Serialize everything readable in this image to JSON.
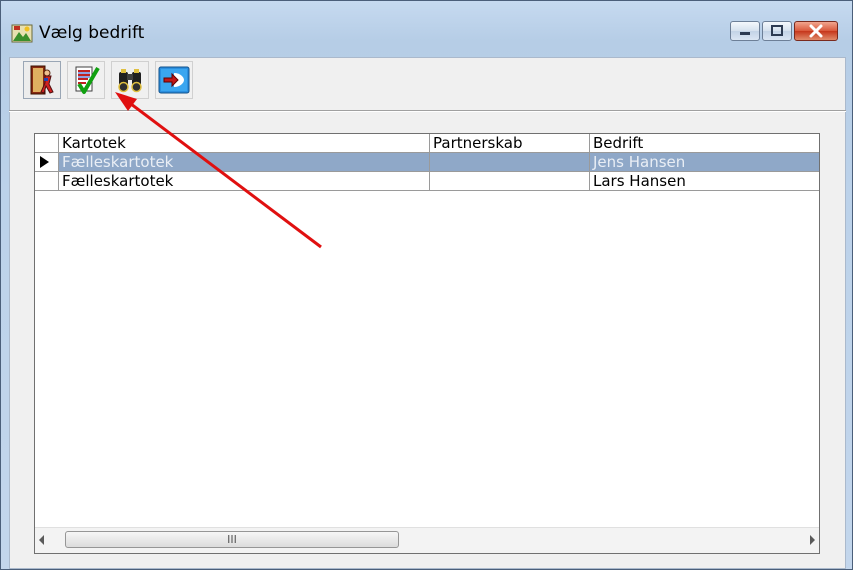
{
  "window": {
    "title": "Vælg bedrift"
  },
  "toolbar": {
    "buttons": [
      {
        "name": "exit",
        "icon": "door-exit-icon"
      },
      {
        "name": "select",
        "icon": "checklist-icon"
      },
      {
        "name": "search",
        "icon": "binoculars-icon"
      },
      {
        "name": "import",
        "icon": "arrow-import-icon"
      }
    ]
  },
  "grid": {
    "columns": [
      "Kartotek",
      "Partnerskab",
      "Bedrift",
      ""
    ],
    "rows": [
      {
        "kartotek": "Fælleskartotek",
        "partnerskab": "",
        "bedrift": "Jens Hansen",
        "selected": true
      },
      {
        "kartotek": "Fælleskartotek",
        "partnerskab": "",
        "bedrift": "Lars Hansen",
        "selected": false
      }
    ]
  },
  "scrollbar": {
    "grip": "III"
  },
  "colors": {
    "selection": "#8fa8c8",
    "annotation_arrow": "#e01010"
  }
}
